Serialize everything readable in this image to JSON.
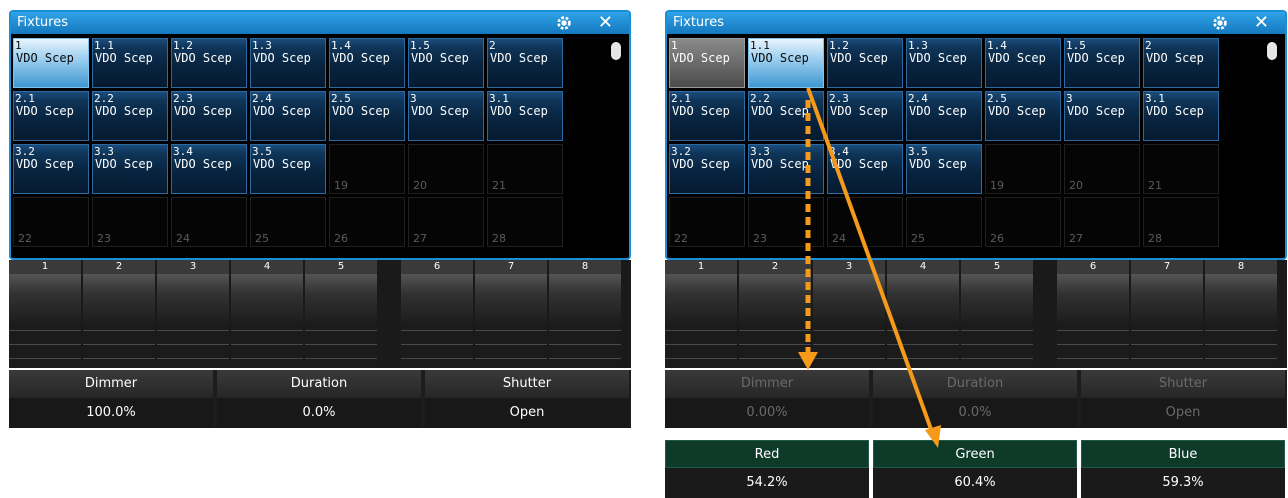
{
  "left": {
    "title": "Fixtures",
    "fixtures": [
      {
        "num": "1",
        "name": "VDO Scep",
        "state": "selected"
      },
      {
        "num": "1.1",
        "name": "VDO Scep",
        "state": "normal"
      },
      {
        "num": "1.2",
        "name": "VDO Scep",
        "state": "normal"
      },
      {
        "num": "1.3",
        "name": "VDO Scep",
        "state": "normal"
      },
      {
        "num": "1.4",
        "name": "VDO Scep",
        "state": "normal"
      },
      {
        "num": "1.5",
        "name": "VDO Scep",
        "state": "normal"
      },
      {
        "num": "2",
        "name": "VDO Scep",
        "state": "normal"
      },
      {
        "num": "2.1",
        "name": "VDO Scep",
        "state": "normal"
      },
      {
        "num": "2.2",
        "name": "VDO Scep",
        "state": "normal"
      },
      {
        "num": "2.3",
        "name": "VDO Scep",
        "state": "normal"
      },
      {
        "num": "2.4",
        "name": "VDO Scep",
        "state": "normal"
      },
      {
        "num": "2.5",
        "name": "VDO Scep",
        "state": "normal"
      },
      {
        "num": "3",
        "name": "VDO Scep",
        "state": "normal"
      },
      {
        "num": "3.1",
        "name": "VDO Scep",
        "state": "normal"
      },
      {
        "num": "3.2",
        "name": "VDO Scep",
        "state": "normal"
      },
      {
        "num": "3.3",
        "name": "VDO Scep",
        "state": "normal"
      },
      {
        "num": "3.4",
        "name": "VDO Scep",
        "state": "normal"
      },
      {
        "num": "3.5",
        "name": "VDO Scep",
        "state": "normal"
      },
      {
        "num": "19",
        "name": "",
        "state": "empty"
      },
      {
        "num": "20",
        "name": "",
        "state": "empty"
      },
      {
        "num": "21",
        "name": "",
        "state": "empty"
      },
      {
        "num": "22",
        "name": "",
        "state": "empty"
      },
      {
        "num": "23",
        "name": "",
        "state": "empty"
      },
      {
        "num": "24",
        "name": "",
        "state": "empty"
      },
      {
        "num": "25",
        "name": "",
        "state": "empty"
      },
      {
        "num": "26",
        "name": "",
        "state": "empty"
      },
      {
        "num": "27",
        "name": "",
        "state": "empty"
      },
      {
        "num": "28",
        "name": "",
        "state": "empty"
      }
    ],
    "channels": [
      "1",
      "2",
      "3",
      "4",
      "5",
      "6",
      "7",
      "8"
    ],
    "params": [
      {
        "name": "Dimmer",
        "value": "100.0%"
      },
      {
        "name": "Duration",
        "value": "0.0%"
      },
      {
        "name": "Shutter",
        "value": "Open"
      }
    ]
  },
  "right": {
    "title": "Fixtures",
    "fixtures": [
      {
        "num": "1",
        "name": "VDO Scep",
        "state": "grey"
      },
      {
        "num": "1.1",
        "name": "VDO Scep",
        "state": "selected"
      },
      {
        "num": "1.2",
        "name": "VDO Scep",
        "state": "normal"
      },
      {
        "num": "1.3",
        "name": "VDO Scep",
        "state": "normal"
      },
      {
        "num": "1.4",
        "name": "VDO Scep",
        "state": "normal"
      },
      {
        "num": "1.5",
        "name": "VDO Scep",
        "state": "normal"
      },
      {
        "num": "2",
        "name": "VDO Scep",
        "state": "normal"
      },
      {
        "num": "2.1",
        "name": "VDO Scep",
        "state": "normal"
      },
      {
        "num": "2.2",
        "name": "VDO Scep",
        "state": "normal"
      },
      {
        "num": "2.3",
        "name": "VDO Scep",
        "state": "normal"
      },
      {
        "num": "2.4",
        "name": "VDO Scep",
        "state": "normal"
      },
      {
        "num": "2.5",
        "name": "VDO Scep",
        "state": "normal"
      },
      {
        "num": "3",
        "name": "VDO Scep",
        "state": "normal"
      },
      {
        "num": "3.1",
        "name": "VDO Scep",
        "state": "normal"
      },
      {
        "num": "3.2",
        "name": "VDO Scep",
        "state": "normal"
      },
      {
        "num": "3.3",
        "name": "VDO Scep",
        "state": "normal"
      },
      {
        "num": "3.4",
        "name": "VDO Scep",
        "state": "normal"
      },
      {
        "num": "3.5",
        "name": "VDO Scep",
        "state": "normal"
      },
      {
        "num": "19",
        "name": "",
        "state": "empty"
      },
      {
        "num": "20",
        "name": "",
        "state": "empty"
      },
      {
        "num": "21",
        "name": "",
        "state": "empty"
      },
      {
        "num": "22",
        "name": "",
        "state": "empty"
      },
      {
        "num": "23",
        "name": "",
        "state": "empty"
      },
      {
        "num": "24",
        "name": "",
        "state": "empty"
      },
      {
        "num": "25",
        "name": "",
        "state": "empty"
      },
      {
        "num": "26",
        "name": "",
        "state": "empty"
      },
      {
        "num": "27",
        "name": "",
        "state": "empty"
      },
      {
        "num": "28",
        "name": "",
        "state": "empty"
      }
    ],
    "channels": [
      "1",
      "2",
      "3",
      "4",
      "5",
      "6",
      "7",
      "8"
    ],
    "params": [
      {
        "name": "Dimmer",
        "value": "0.00%"
      },
      {
        "name": "Duration",
        "value": "0.0%"
      },
      {
        "name": "Shutter",
        "value": "Open"
      }
    ],
    "color_params": [
      {
        "name": "Red",
        "value": "54.2%"
      },
      {
        "name": "Green",
        "value": "60.4%"
      },
      {
        "name": "Blue",
        "value": "59.3%"
      }
    ]
  },
  "colors": {
    "accent": "#1b8fd6",
    "arrow": "#f59a1b",
    "color_header": "#0e3a2a"
  }
}
